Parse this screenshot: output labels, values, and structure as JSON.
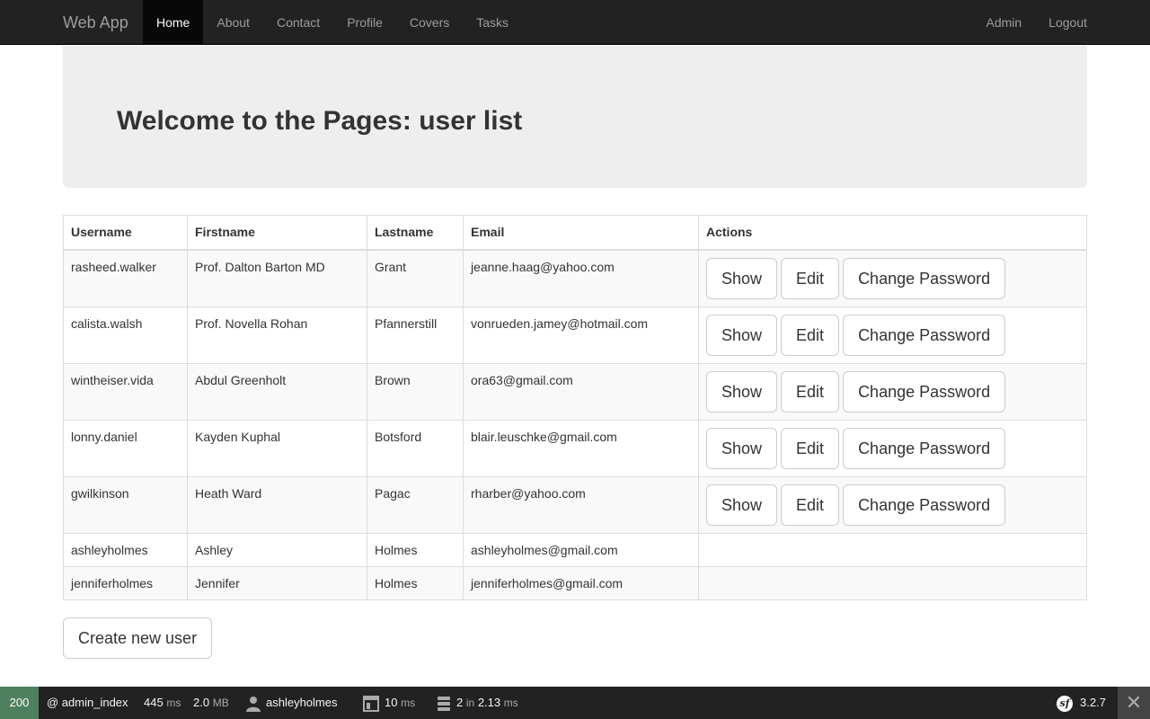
{
  "navbar": {
    "brand": "Web App",
    "items": [
      "Home",
      "About",
      "Contact",
      "Profile",
      "Covers",
      "Tasks"
    ],
    "active": "Home",
    "right_items": [
      "Admin",
      "Logout"
    ]
  },
  "jumbotron": {
    "title": "Welcome to the Pages: user list"
  },
  "table": {
    "headers": [
      "Username",
      "Firstname",
      "Lastname",
      "Email",
      "Actions"
    ],
    "action_labels": {
      "show": "Show",
      "edit": "Edit",
      "change_password": "Change Password"
    },
    "rows": [
      {
        "username": "rasheed.walker",
        "firstname": "Prof. Dalton Barton MD",
        "lastname": "Grant",
        "email": "jeanne.haag@yahoo.com",
        "has_actions": true
      },
      {
        "username": "calista.walsh",
        "firstname": "Prof. Novella Rohan",
        "lastname": "Pfannerstill",
        "email": "vonrueden.jamey@hotmail.com",
        "has_actions": true
      },
      {
        "username": "wintheiser.vida",
        "firstname": "Abdul Greenholt",
        "lastname": "Brown",
        "email": "ora63@gmail.com",
        "has_actions": true
      },
      {
        "username": "lonny.daniel",
        "firstname": "Kayden Kuphal",
        "lastname": "Botsford",
        "email": "blair.leuschke@gmail.com",
        "has_actions": true
      },
      {
        "username": "gwilkinson",
        "firstname": "Heath Ward",
        "lastname": "Pagac",
        "email": "rharber@yahoo.com",
        "has_actions": true
      },
      {
        "username": "ashleyholmes",
        "firstname": "Ashley",
        "lastname": "Holmes",
        "email": "ashleyholmes@gmail.com",
        "has_actions": false
      },
      {
        "username": "jenniferholmes",
        "firstname": "Jennifer",
        "lastname": "Holmes",
        "email": "jenniferholmes@gmail.com",
        "has_actions": false
      }
    ]
  },
  "create_button": "Create new user",
  "toolbar": {
    "status_code": "200",
    "route": "@ admin_index",
    "time_value": "445",
    "time_unit": "ms",
    "memory_value": "2.0",
    "memory_unit": "MB",
    "user": "ashleyholmes",
    "render_value": "10",
    "render_unit": "ms",
    "db_queries": "2",
    "db_in": "in",
    "db_time": "2.13",
    "db_unit": "ms",
    "version": "3.2.7",
    "status_color": "#4f805d"
  }
}
